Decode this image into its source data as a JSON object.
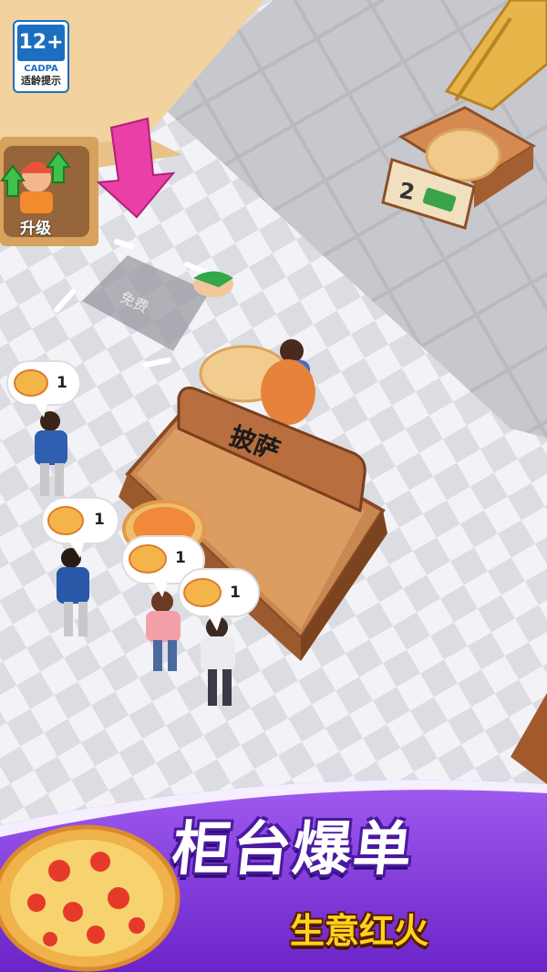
{
  "age_rating": {
    "badge": "12+",
    "org": "CADPA",
    "note": "适龄提示"
  },
  "upgrade_button": {
    "label": "升级"
  },
  "free_spot": {
    "label": "免费"
  },
  "pickup_tray": {
    "price": "2"
  },
  "counter": {
    "sign": "披萨"
  },
  "customers": [
    {
      "order_count": "1"
    },
    {
      "order_count": "1"
    },
    {
      "order_count": "1"
    },
    {
      "order_count": "1"
    }
  ],
  "banner": {
    "title": "柜台爆单",
    "subtitle": "生意红火"
  },
  "colors": {
    "floor_wood": "#f0cf99",
    "tile": "#d8d8de",
    "counter_wood": "#b8764a",
    "arrow": "#ea3fa6",
    "banner_purple": "#8a3fe3",
    "subtitle_yellow": "#ffd21f"
  }
}
